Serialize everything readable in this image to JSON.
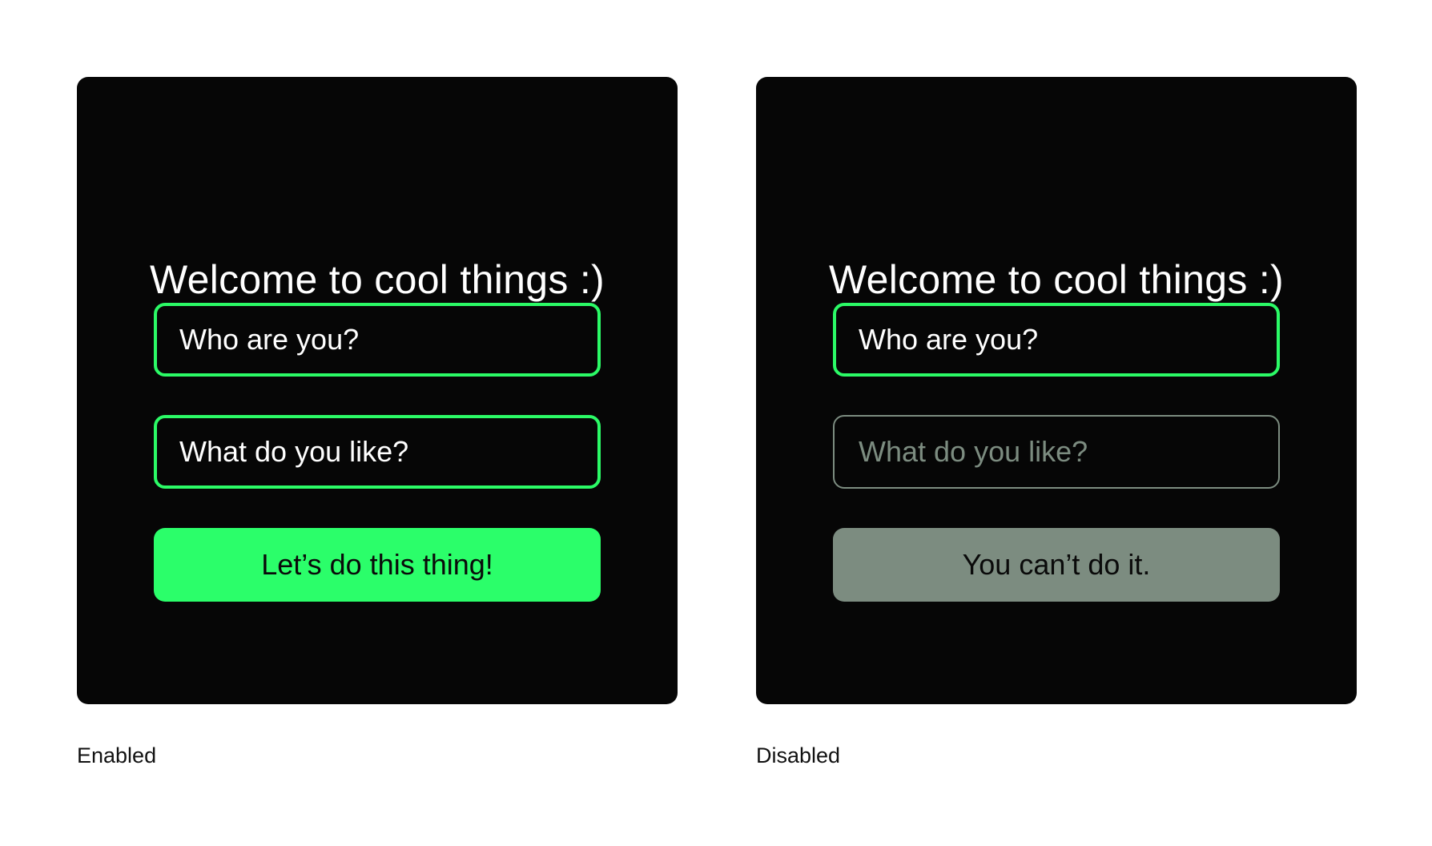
{
  "colors": {
    "background": "#ffffff",
    "panel": "#060606",
    "accent_green": "#2bfa66",
    "disabled_gray": "#7c8c80",
    "text_light": "#ffffff",
    "text_dark": "#0a0a0a"
  },
  "enabled": {
    "title": "Welcome to cool things :)",
    "field_name_placeholder": "Who are you?",
    "field_likes_placeholder": "What do you like?",
    "button_label": "Let’s do this thing!",
    "state_label": "Enabled"
  },
  "disabled": {
    "title": "Welcome to cool things :)",
    "field_name_placeholder": "Who are you?",
    "field_likes_placeholder": "What do you like?",
    "button_label": "You can’t do it.",
    "state_label": "Disabled"
  }
}
